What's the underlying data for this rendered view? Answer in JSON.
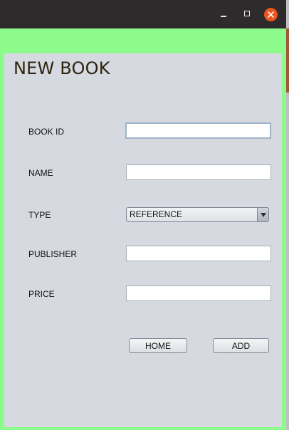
{
  "window": {
    "controls": {
      "minimize_icon": "minimize-icon",
      "maximize_icon": "maximize-icon",
      "close_icon": "close-icon",
      "close_color": "#e95420"
    }
  },
  "form": {
    "title": "NEW BOOK",
    "fields": {
      "book_id": {
        "label": "BOOK ID",
        "value": ""
      },
      "name": {
        "label": "NAME",
        "value": ""
      },
      "type": {
        "label": "TYPE",
        "value": "REFERENCE"
      },
      "publisher": {
        "label": "PUBLISHER",
        "value": ""
      },
      "price": {
        "label": "PRICE",
        "value": ""
      }
    },
    "buttons": {
      "home": "HOME",
      "add": "ADD"
    }
  },
  "colors": {
    "frame_background": "#8cfb8c",
    "panel_background": "#d6d9df",
    "title_color": "#2e2410"
  }
}
